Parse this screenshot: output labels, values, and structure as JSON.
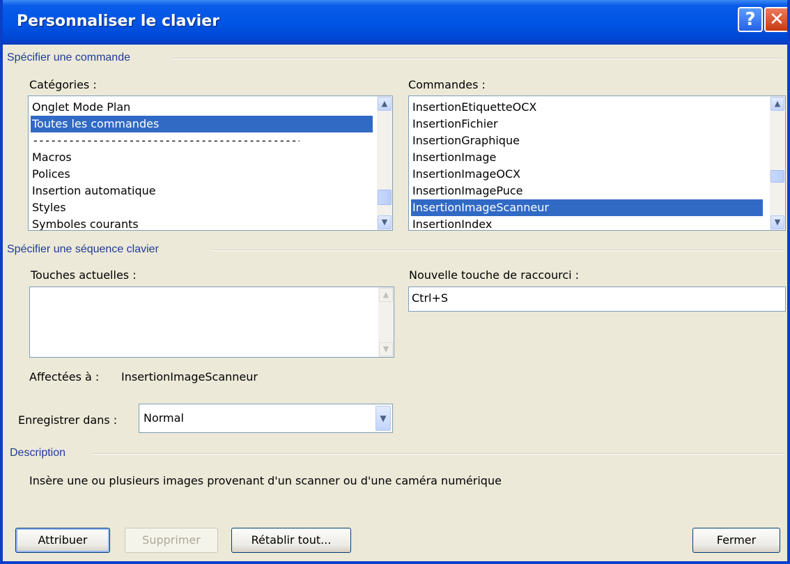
{
  "window": {
    "title": "Personnaliser le clavier",
    "help_glyph": "?",
    "close_glyph": "✕"
  },
  "command_section": {
    "heading": "Spécifier une commande",
    "categories_label": "Catégories :",
    "categories": [
      "Onglet Mode Plan",
      "Toutes les commandes",
      "---------------------------------------------------",
      "Macros",
      "Polices",
      "Insertion automatique",
      "Styles",
      "Symboles courants"
    ],
    "categories_selected": "Toutes les commandes",
    "commands_label": "Commandes :",
    "commands": [
      "InsertionEtiquetteOCX",
      "InsertionFichier",
      "InsertionGraphique",
      "InsertionImage",
      "InsertionImageOCX",
      "InsertionImagePuce",
      "InsertionImageScanneur",
      "InsertionIndex"
    ],
    "commands_selected": "InsertionImageScanneur"
  },
  "key_section": {
    "heading": "Spécifier une séquence clavier",
    "current_keys_label": "Touches actuelles :",
    "current_keys": [],
    "new_key_label": "Nouvelle touche de raccourci :",
    "new_key_value": "Ctrl+S",
    "assigned_label": "Affectées à :",
    "assigned_value": "InsertionImageScanneur"
  },
  "save_in": {
    "label": "Enregistrer dans :",
    "value": "Normal"
  },
  "description_section": {
    "heading": "Description",
    "text": "Insère une ou plusieurs images provenant d'un scanner ou d'une caméra numérique"
  },
  "buttons": {
    "assign": "Attribuer",
    "remove": "Supprimer",
    "reset_all": "Rétablir tout...",
    "close": "Fermer"
  },
  "colors": {
    "titlebar": "#0055e5",
    "selection": "#316ac5",
    "group_heading": "#1f3b9c",
    "dialog_bg": "#ece9d8"
  }
}
